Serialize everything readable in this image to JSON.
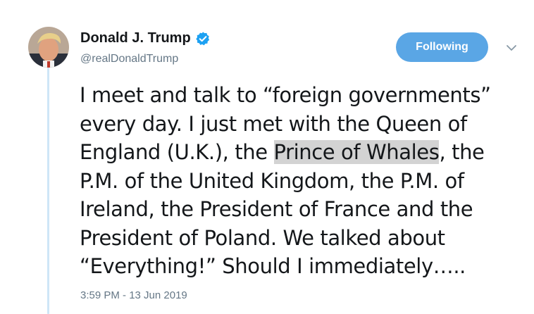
{
  "author": {
    "display_name": "Donald J. Trump",
    "screen_name": "@realDonaldTrump",
    "verified": true
  },
  "actions": {
    "follow_label": "Following",
    "menu_icon": "chevron-down-icon"
  },
  "tweet": {
    "lines": [
      {
        "text": "I meet and talk to “foreign governments”"
      },
      {
        "text": "every day. I just met with the Queen of"
      },
      {
        "before": "England (U.K.), the ",
        "highlight": "Prince of Whales",
        "after": ", the"
      },
      {
        "text": "P.M. of the United Kingdom, the P.M. of"
      },
      {
        "text": "Ireland, the President of France and the"
      },
      {
        "text": "President of Poland. We talked about"
      },
      {
        "text": "“Everything!” Should I immediately….."
      }
    ],
    "timestamp": "3:59 PM - 13 Jun 2019"
  },
  "colors": {
    "button_bg": "#5aa6e5",
    "verified_blue": "#1da1f2",
    "muted": "#657786",
    "highlight": "#d3d3d3",
    "thread_line": "#cfe6f7"
  }
}
